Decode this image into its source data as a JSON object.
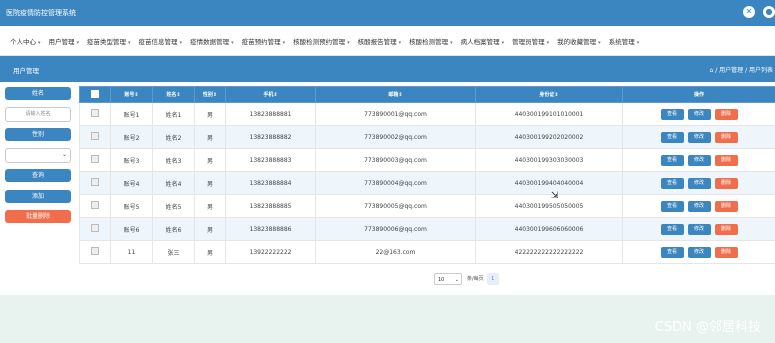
{
  "header": {
    "title": "医院疫情防控管理系统",
    "icons": [
      "close-circle-icon",
      "user-icon"
    ]
  },
  "nav": [
    "个人中心",
    "用户管理",
    "疫苗类型管理",
    "疫苗信息管理",
    "疫情数据管理",
    "疫苗预约管理",
    "核酸检测预约管理",
    "核酸报告管理",
    "核酸检测管理",
    "病人档案管理",
    "管理员管理",
    "我的收藏管理",
    "系统管理"
  ],
  "subheader": {
    "title": "用户管理",
    "breadcrumb": "⌂ / 用户管理 / 用户列表"
  },
  "sidebar": {
    "name_label": "姓名",
    "name_placeholder": "请输入姓名",
    "gender_label": "性别",
    "gender_value": "",
    "query": "查询",
    "add": "添加",
    "batch_delete": "批量删除"
  },
  "table": {
    "columns": [
      "",
      "账号⇕",
      "姓名⇕",
      "性别⇕",
      "手机⇕",
      "邮箱⇕",
      "身份证⇕",
      "操作"
    ],
    "rows": [
      [
        "账号1",
        "姓名1",
        "男",
        "13823888881",
        "773890001@qq.com",
        "440300199101010001"
      ],
      [
        "账号2",
        "姓名2",
        "男",
        "13823888882",
        "773890002@qq.com",
        "440300199202020002"
      ],
      [
        "账号3",
        "姓名3",
        "男",
        "13823888883",
        "773890003@qq.com",
        "440300199303030003"
      ],
      [
        "账号4",
        "姓名4",
        "男",
        "13823888884",
        "773890004@qq.com",
        "440300199404040004"
      ],
      [
        "账号5",
        "姓名5",
        "男",
        "13823888885",
        "773890005@qq.com",
        "440300199505050005"
      ],
      [
        "账号6",
        "姓名6",
        "男",
        "13823888886",
        "773890006@qq.com",
        "440300199606060006"
      ],
      [
        "11",
        "张三",
        "男",
        "13922222222",
        "22@163.com",
        "422222222222222222"
      ]
    ],
    "actions": [
      "查看",
      "修改",
      "删除"
    ]
  },
  "pager": {
    "page_size": "10",
    "per_page_label": "条/每页",
    "current_page": "1"
  },
  "watermark": "CSDN @邻居科技"
}
